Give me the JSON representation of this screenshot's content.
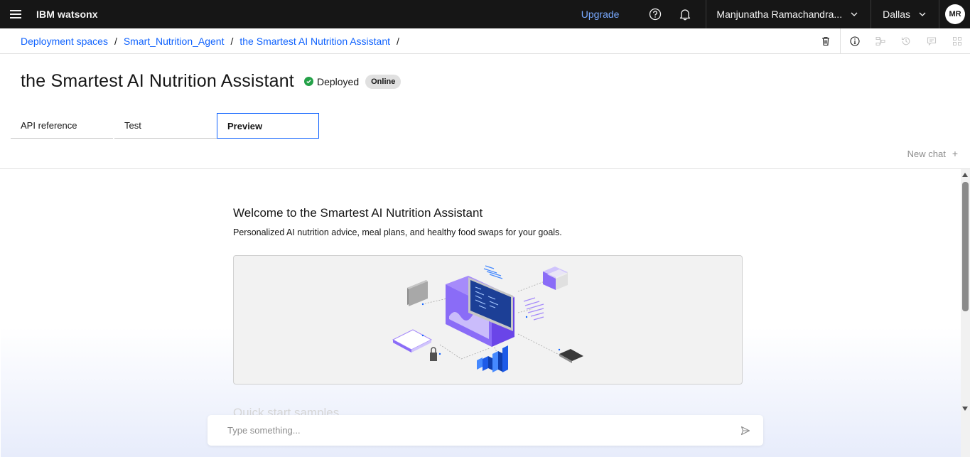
{
  "header": {
    "brand_prefix": "IBM",
    "brand_name": "watsonx",
    "upgrade_label": "Upgrade",
    "user_name": "Manjunatha Ramachandra...",
    "region": "Dallas",
    "avatar_initials": "MR",
    "icons": [
      "hamburger-menu-icon",
      "help-icon",
      "notification-bell-icon",
      "chevron-down-icon"
    ]
  },
  "breadcrumb": {
    "items": [
      "Deployment spaces",
      "Smart_Nutrition_Agent",
      "the Smartest AI Nutrition Assistant"
    ],
    "separator": "/",
    "action_icons": [
      "delete-icon",
      "info-icon",
      "flow-icon",
      "history-icon",
      "comment-icon",
      "apps-icon"
    ]
  },
  "page": {
    "title": "the Smartest AI Nutrition Assistant",
    "status": "Deployed",
    "badge": "Online"
  },
  "tabs": [
    {
      "label": "API reference",
      "active": false
    },
    {
      "label": "Test",
      "active": false
    },
    {
      "label": "Preview",
      "active": true
    }
  ],
  "chat": {
    "new_chat_label": "New chat",
    "welcome_title": "Welcome to the Smartest AI Nutrition Assistant",
    "welcome_subtitle": "Personalized AI nutrition advice, meal plans, and healthy food swaps for your goals.",
    "quick_start_label": "Quick start samples",
    "input_placeholder": "Type something..."
  },
  "colors": {
    "topbar_bg": "#161616",
    "link": "#0f62fe",
    "upgrade": "#78a9ff",
    "deployed_green": "#24a148",
    "illustration_purple": "#8a6cf7",
    "illustration_blue": "#1d5be8"
  }
}
